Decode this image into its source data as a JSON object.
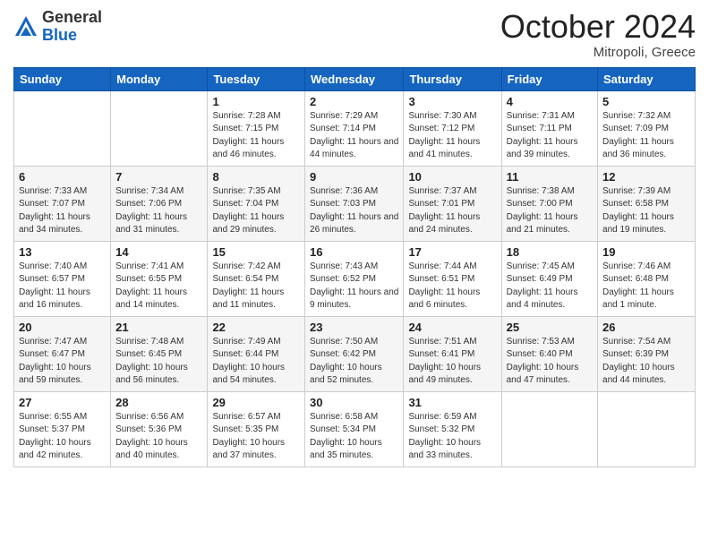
{
  "header": {
    "logo_general": "General",
    "logo_blue": "Blue",
    "month_title": "October 2024",
    "subtitle": "Mitropoli, Greece"
  },
  "days_of_week": [
    "Sunday",
    "Monday",
    "Tuesday",
    "Wednesday",
    "Thursday",
    "Friday",
    "Saturday"
  ],
  "weeks": [
    [
      {
        "day": "",
        "info": ""
      },
      {
        "day": "",
        "info": ""
      },
      {
        "day": "1",
        "info": "Sunrise: 7:28 AM\nSunset: 7:15 PM\nDaylight: 11 hours and 46 minutes."
      },
      {
        "day": "2",
        "info": "Sunrise: 7:29 AM\nSunset: 7:14 PM\nDaylight: 11 hours and 44 minutes."
      },
      {
        "day": "3",
        "info": "Sunrise: 7:30 AM\nSunset: 7:12 PM\nDaylight: 11 hours and 41 minutes."
      },
      {
        "day": "4",
        "info": "Sunrise: 7:31 AM\nSunset: 7:11 PM\nDaylight: 11 hours and 39 minutes."
      },
      {
        "day": "5",
        "info": "Sunrise: 7:32 AM\nSunset: 7:09 PM\nDaylight: 11 hours and 36 minutes."
      }
    ],
    [
      {
        "day": "6",
        "info": "Sunrise: 7:33 AM\nSunset: 7:07 PM\nDaylight: 11 hours and 34 minutes."
      },
      {
        "day": "7",
        "info": "Sunrise: 7:34 AM\nSunset: 7:06 PM\nDaylight: 11 hours and 31 minutes."
      },
      {
        "day": "8",
        "info": "Sunrise: 7:35 AM\nSunset: 7:04 PM\nDaylight: 11 hours and 29 minutes."
      },
      {
        "day": "9",
        "info": "Sunrise: 7:36 AM\nSunset: 7:03 PM\nDaylight: 11 hours and 26 minutes."
      },
      {
        "day": "10",
        "info": "Sunrise: 7:37 AM\nSunset: 7:01 PM\nDaylight: 11 hours and 24 minutes."
      },
      {
        "day": "11",
        "info": "Sunrise: 7:38 AM\nSunset: 7:00 PM\nDaylight: 11 hours and 21 minutes."
      },
      {
        "day": "12",
        "info": "Sunrise: 7:39 AM\nSunset: 6:58 PM\nDaylight: 11 hours and 19 minutes."
      }
    ],
    [
      {
        "day": "13",
        "info": "Sunrise: 7:40 AM\nSunset: 6:57 PM\nDaylight: 11 hours and 16 minutes."
      },
      {
        "day": "14",
        "info": "Sunrise: 7:41 AM\nSunset: 6:55 PM\nDaylight: 11 hours and 14 minutes."
      },
      {
        "day": "15",
        "info": "Sunrise: 7:42 AM\nSunset: 6:54 PM\nDaylight: 11 hours and 11 minutes."
      },
      {
        "day": "16",
        "info": "Sunrise: 7:43 AM\nSunset: 6:52 PM\nDaylight: 11 hours and 9 minutes."
      },
      {
        "day": "17",
        "info": "Sunrise: 7:44 AM\nSunset: 6:51 PM\nDaylight: 11 hours and 6 minutes."
      },
      {
        "day": "18",
        "info": "Sunrise: 7:45 AM\nSunset: 6:49 PM\nDaylight: 11 hours and 4 minutes."
      },
      {
        "day": "19",
        "info": "Sunrise: 7:46 AM\nSunset: 6:48 PM\nDaylight: 11 hours and 1 minute."
      }
    ],
    [
      {
        "day": "20",
        "info": "Sunrise: 7:47 AM\nSunset: 6:47 PM\nDaylight: 10 hours and 59 minutes."
      },
      {
        "day": "21",
        "info": "Sunrise: 7:48 AM\nSunset: 6:45 PM\nDaylight: 10 hours and 56 minutes."
      },
      {
        "day": "22",
        "info": "Sunrise: 7:49 AM\nSunset: 6:44 PM\nDaylight: 10 hours and 54 minutes."
      },
      {
        "day": "23",
        "info": "Sunrise: 7:50 AM\nSunset: 6:42 PM\nDaylight: 10 hours and 52 minutes."
      },
      {
        "day": "24",
        "info": "Sunrise: 7:51 AM\nSunset: 6:41 PM\nDaylight: 10 hours and 49 minutes."
      },
      {
        "day": "25",
        "info": "Sunrise: 7:53 AM\nSunset: 6:40 PM\nDaylight: 10 hours and 47 minutes."
      },
      {
        "day": "26",
        "info": "Sunrise: 7:54 AM\nSunset: 6:39 PM\nDaylight: 10 hours and 44 minutes."
      }
    ],
    [
      {
        "day": "27",
        "info": "Sunrise: 6:55 AM\nSunset: 5:37 PM\nDaylight: 10 hours and 42 minutes."
      },
      {
        "day": "28",
        "info": "Sunrise: 6:56 AM\nSunset: 5:36 PM\nDaylight: 10 hours and 40 minutes."
      },
      {
        "day": "29",
        "info": "Sunrise: 6:57 AM\nSunset: 5:35 PM\nDaylight: 10 hours and 37 minutes."
      },
      {
        "day": "30",
        "info": "Sunrise: 6:58 AM\nSunset: 5:34 PM\nDaylight: 10 hours and 35 minutes."
      },
      {
        "day": "31",
        "info": "Sunrise: 6:59 AM\nSunset: 5:32 PM\nDaylight: 10 hours and 33 minutes."
      },
      {
        "day": "",
        "info": ""
      },
      {
        "day": "",
        "info": ""
      }
    ]
  ]
}
